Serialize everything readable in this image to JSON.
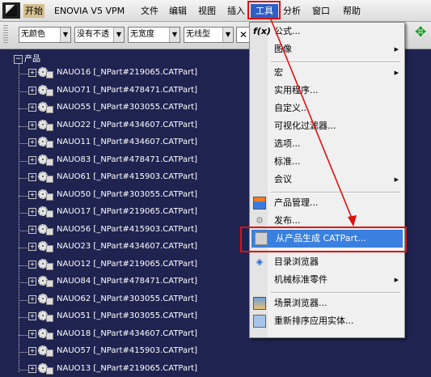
{
  "menubar": {
    "items": [
      "开始",
      "ENOVIA V5 VPM",
      "文件",
      "编辑",
      "视图",
      "插入",
      "工具",
      "分析",
      "窗口",
      "帮助"
    ]
  },
  "toolbar": {
    "color_select": "无颜色",
    "transparency_select": "没有不透",
    "linewidth_select": "无宽度",
    "linetype_select": "无线型",
    "close_glyph": "✕"
  },
  "tree": {
    "root_label": "产品",
    "parts": [
      "NAUO16 [_NPart#219065.CATPart]",
      "NAUO71 [_NPart#478471.CATPart]",
      "NAUO55 [_NPart#303055.CATPart]",
      "NAUO22 [_NPart#434607.CATPart]",
      "NAUO11 [_NPart#434607.CATPart]",
      "NAUO83 [_NPart#478471.CATPart]",
      "NAUO61 [_NPart#415903.CATPart]",
      "NAUO50 [_NPart#303055.CATPart]",
      "NAUO17 [_NPart#219065.CATPart]",
      "NAUO56 [_NPart#415903.CATPart]",
      "NAUO23 [_NPart#434607.CATPart]",
      "NAUO12 [_NPart#219065.CATPart]",
      "NAUO84 [_NPart#478471.CATPart]",
      "NAUO62 [_NPart#303055.CATPart]",
      "NAUO51 [_NPart#303055.CATPart]",
      "NAUO18 [_NPart#434607.CATPart]",
      "NAUO57 [_NPart#415903.CATPart]",
      "NAUO13 [_NPart#219065.CATPart]"
    ]
  },
  "tools_menu": {
    "formula": "公式...",
    "image": "图像",
    "macro": "宏",
    "utility": "实用程序...",
    "customize": "自定义...",
    "visual_filter": "可视化过滤器...",
    "options": "选项...",
    "standards": "标准...",
    "conference": "会议",
    "product_management": "产品管理...",
    "publish": "发布...",
    "generate_catpart": "从产品生成 CATPart...",
    "catalog_browser": "目录浏览器",
    "mech_std_parts": "机械标准零件",
    "scene_browser": "场景浏览器...",
    "reorder_instances": "重新排序应用实体...",
    "highlight_color": "#3a80e0",
    "annotation_color": "#e01010"
  }
}
